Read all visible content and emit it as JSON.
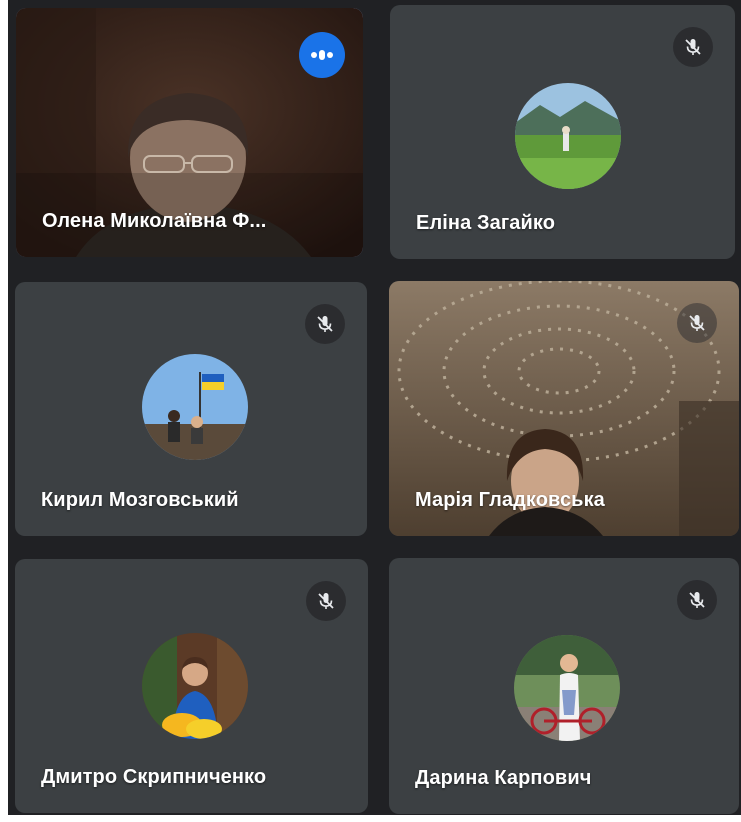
{
  "meeting": {
    "participants": [
      {
        "name": "Олена Миколаївна Ф...",
        "media": "camera",
        "speaking": true,
        "muted": false
      },
      {
        "name": "Еліна Загайко",
        "media": "avatar",
        "speaking": false,
        "muted": true
      },
      {
        "name": "Кирил Мозговський",
        "media": "avatar",
        "speaking": false,
        "muted": true
      },
      {
        "name": "Марія Гладковська",
        "media": "camera",
        "speaking": false,
        "muted": true
      },
      {
        "name": "Дмитро Скрипниченко",
        "media": "avatar",
        "speaking": false,
        "muted": true
      },
      {
        "name": "Дарина Карпович",
        "media": "avatar",
        "speaking": false,
        "muted": true
      }
    ]
  },
  "colors": {
    "stage_bg": "#202124",
    "tile_bg": "#3c4043",
    "active_border": "#8ab4f8",
    "speaking_badge": "#1a73e8",
    "text": "#ffffff"
  }
}
